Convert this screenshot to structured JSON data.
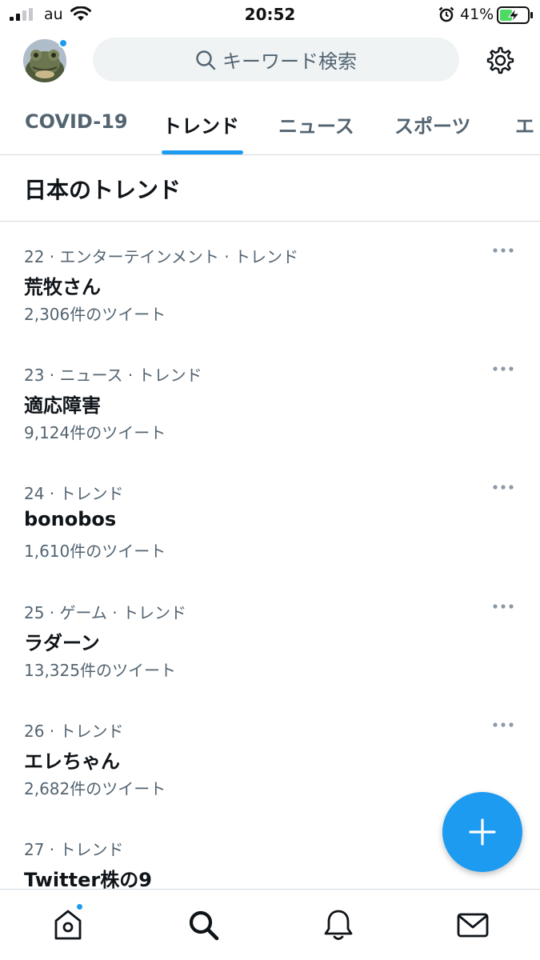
{
  "status_bar": {
    "carrier": "au",
    "time": "20:52",
    "battery_percent": "41%"
  },
  "header": {
    "search_placeholder": "キーワード検索"
  },
  "tabs": [
    {
      "label": "COVID-19",
      "active": false
    },
    {
      "label": "トレンド",
      "active": true
    },
    {
      "label": "ニュース",
      "active": false
    },
    {
      "label": "スポーツ",
      "active": false
    },
    {
      "label": "エ",
      "active": false
    }
  ],
  "section_title": "日本のトレンド",
  "trends": [
    {
      "meta": "22 · エンターテインメント · トレンド",
      "name": "荒牧さん",
      "count": "2,306件のツイート"
    },
    {
      "meta": "23 · ニュース · トレンド",
      "name": "適応障害",
      "count": "9,124件のツイート"
    },
    {
      "meta": "24 · トレンド",
      "name": "bonobos",
      "count": "1,610件のツイート"
    },
    {
      "meta": "25 · ゲーム · トレンド",
      "name": "ラダーン",
      "count": "13,325件のツイート"
    },
    {
      "meta": "26 · トレンド",
      "name": "エレちゃん",
      "count": "2,682件のツイート"
    },
    {
      "meta": "27 · トレンド",
      "name": "Twitter株の9",
      "count": ""
    }
  ],
  "icons": {
    "search": "search-icon",
    "settings": "gear-icon",
    "more": "more-dots-icon",
    "compose": "plus-icon",
    "home": "home-icon",
    "explore": "search-icon",
    "notifications": "bell-icon",
    "messages": "mail-icon"
  },
  "colors": {
    "accent": "#1d9bf0",
    "text_primary": "#0f1419",
    "text_secondary": "#536471"
  }
}
